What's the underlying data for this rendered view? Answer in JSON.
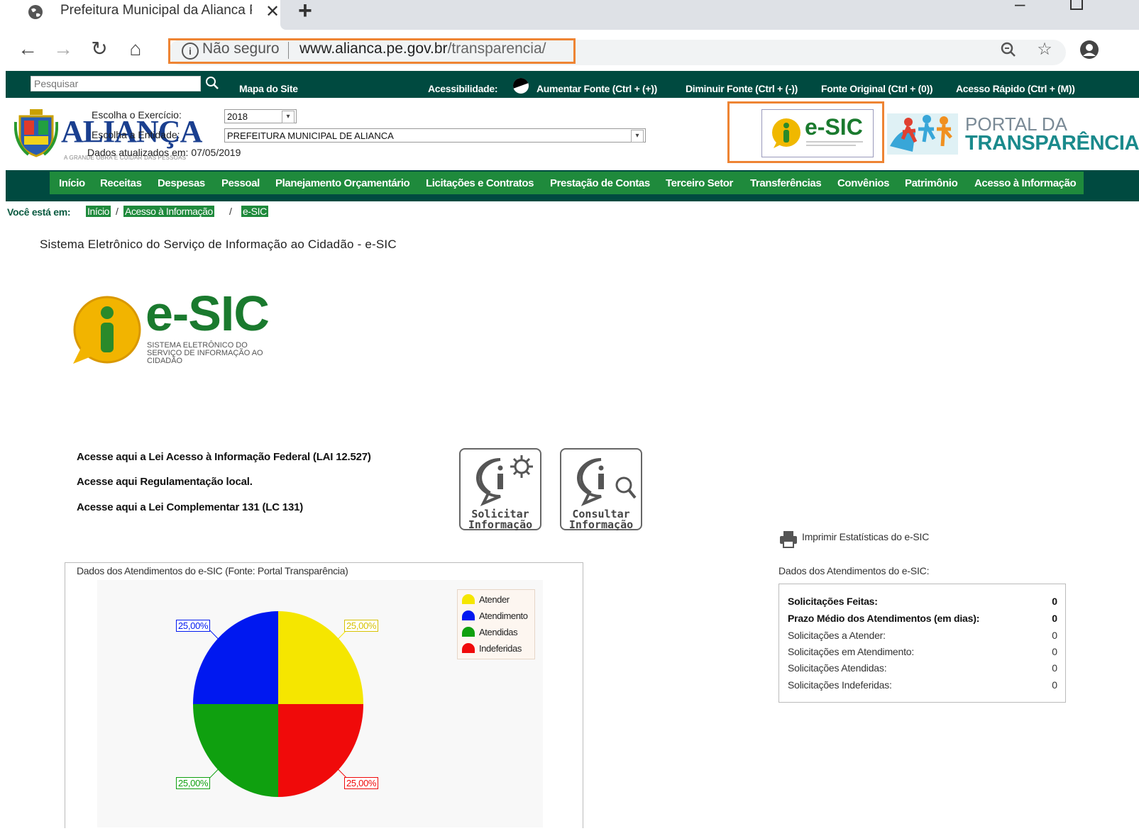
{
  "browser": {
    "tab_title": "Prefeitura Municipal da Alianca P",
    "security_label": "Não seguro",
    "url_host": "www.alianca.pe.gov.br",
    "url_path": "/transparencia/"
  },
  "topbar": {
    "search_placeholder": "Pesquisar",
    "sitemap": "Mapa do Site",
    "accessibility": "Acessibilidade:",
    "font_increase": "Aumentar Fonte (Ctrl + (+))",
    "font_decrease": "Diminuir Fonte (Ctrl + (-))",
    "font_original": "Fonte Original (Ctrl + (0))",
    "quick_access": "Acesso Rápido (Ctrl + (M))"
  },
  "header": {
    "logo_text": "ALIANÇA",
    "logo_tagline": "A GRANDE OBRA É CUIDAR DAS PESSOAS",
    "year_label": "Escolha o Exercício:",
    "year_value": "2018",
    "entity_label": "Escolha a Entidade:",
    "entity_value": "PREFEITURA MUNICIPAL DE ALIANCA",
    "updated_label": "Dados atualizados em:",
    "updated_date": "07/05/2019",
    "esic_badge": "e-SIC",
    "portal_line1": "PORTAL DA",
    "portal_line2": "TRANSPARÊNCIA"
  },
  "nav": {
    "items": [
      "Início",
      "Receitas",
      "Despesas",
      "Pessoal",
      "Planejamento Orçamentário",
      "Licitações e Contratos",
      "Prestação de Contas",
      "Terceiro Setor",
      "Transferências",
      "Convênios",
      "Patrimônio",
      "Acesso à Informação"
    ]
  },
  "breadcrumb": {
    "label": "Você está em:",
    "items": [
      "Início",
      "Acesso à Informação",
      "e-SIC"
    ]
  },
  "main": {
    "title": "Sistema Eletrônico do Serviço de Informação ao Cidadão - e-SIC",
    "logo_text": "e-SIC",
    "logo_sub": "SISTEMA ELETRÔNICO DO SERVIÇO DE INFORMAÇÃO AO CIDADÃO",
    "law_links": [
      "Acesse aqui a Lei Acesso à Informação Federal (LAI 12.527)",
      "Acesse aqui Regulamentação local.",
      "Acesse aqui a Lei Complementar 131 (LC 131)"
    ],
    "btn_request_1": "Solicitar",
    "btn_request_2": "Informação",
    "btn_consult_1": "Consultar",
    "btn_consult_2": "Informação"
  },
  "chart_caption": "Dados dos Atendimentos do e-SIC (Fonte: Portal Transparência)",
  "chart_data": {
    "type": "pie",
    "title": "",
    "series": [
      {
        "name": "Atender",
        "value": 25,
        "label": "25,00%",
        "color": "#f5e600"
      },
      {
        "name": "Atendimento",
        "value": 25,
        "label": "25,00%",
        "color": "#0018f0"
      },
      {
        "name": "Atendidas",
        "value": 25,
        "label": "25,00%",
        "color": "#0fa00f"
      },
      {
        "name": "Indeferidas",
        "value": 25,
        "label": "25,00%",
        "color": "#f00a0a"
      }
    ],
    "legend": "top-right"
  },
  "stats": {
    "print_label": "Imprimir Estatísticas do e-SIC",
    "caption": "Dados dos Atendimentos do e-SIC:",
    "rows": [
      {
        "label": "Solicitações Feitas:",
        "value": "0"
      },
      {
        "label": "Prazo Médio dos Atendimentos (em dias):",
        "value": "0"
      },
      {
        "label": "Solicitações a Atender:",
        "value": "0"
      },
      {
        "label": "Solicitações em Atendimento:",
        "value": "0"
      },
      {
        "label": "Solicitações Atendidas:",
        "value": "0"
      },
      {
        "label": "Solicitações Indeferidas:",
        "value": "0"
      }
    ]
  },
  "colors": {
    "site_dark": "#004a40",
    "site_green": "#1f8a3c",
    "highlight": "#ee8433"
  }
}
